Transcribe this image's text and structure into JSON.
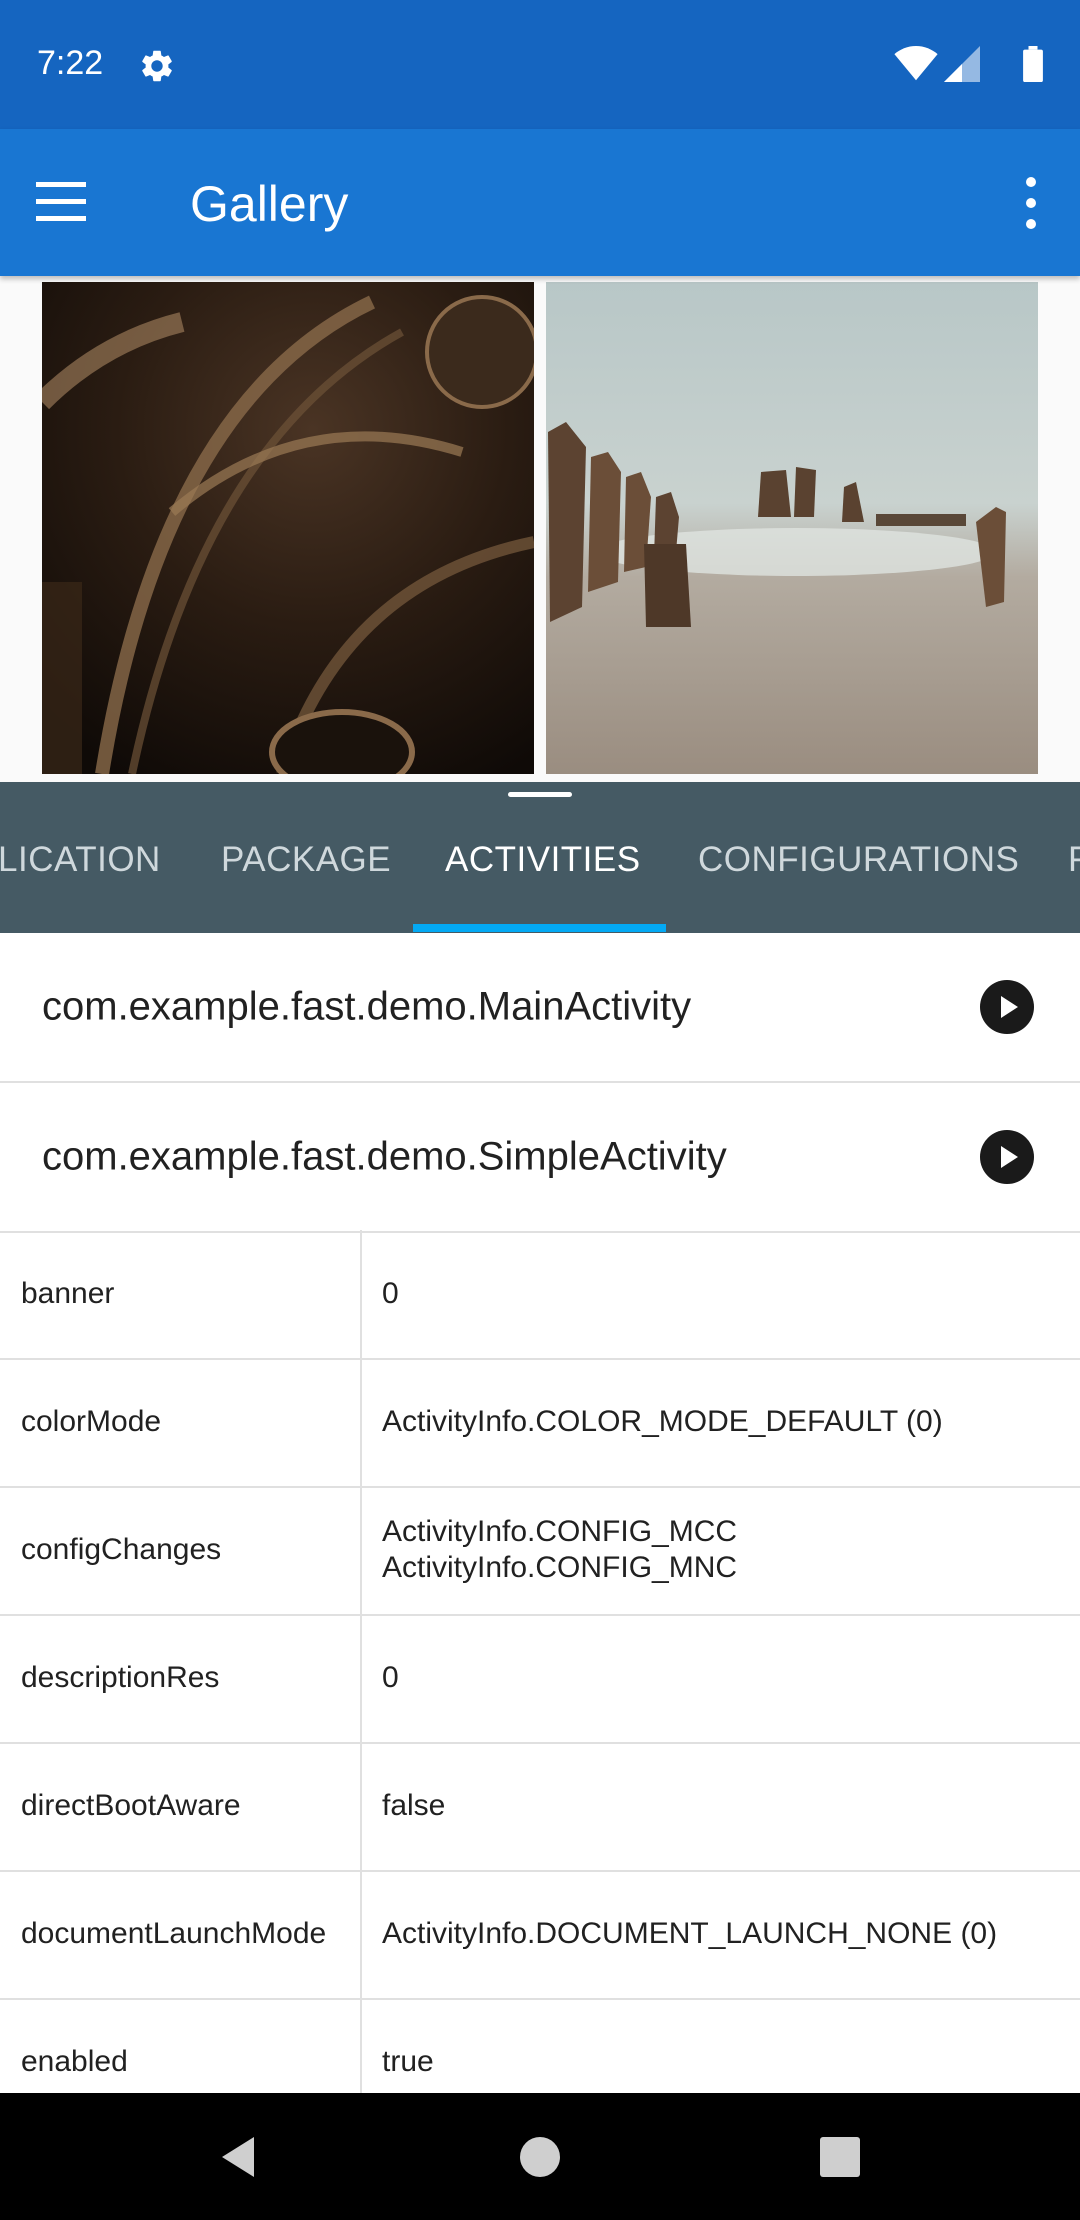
{
  "status_bar": {
    "time": "7:22",
    "icons": [
      "settings-icon",
      "wifi-icon",
      "cell-signal-icon",
      "battery-icon"
    ]
  },
  "app_bar": {
    "title": "Gallery",
    "background": "#1976d2",
    "icons": [
      "menu-icon",
      "more-vert-icon"
    ]
  },
  "gallery": {
    "photos": [
      {
        "name": "cathedral-ceiling-photo"
      },
      {
        "name": "beach-posts-photo"
      }
    ]
  },
  "tabs": {
    "items": [
      {
        "label": "LICATION"
      },
      {
        "label": "PACKAGE"
      },
      {
        "label": "ACTIVITIES",
        "active": true
      },
      {
        "label": "CONFIGURATIONS"
      },
      {
        "label": "F"
      }
    ],
    "background": "#455a64",
    "indicator_color": "#03a9f4"
  },
  "activities": [
    {
      "name": "com.example.fast.demo.MainActivity",
      "icon": "play-circle-icon"
    },
    {
      "name": "com.example.fast.demo.SimpleActivity",
      "icon": "play-circle-icon"
    }
  ],
  "properties": [
    {
      "key": "banner",
      "value": "0"
    },
    {
      "key": "colorMode",
      "value": "ActivityInfo.COLOR_MODE_DEFAULT (0)"
    },
    {
      "key": "configChanges",
      "value": "ActivityInfo.CONFIG_MCC\nActivityInfo.CONFIG_MNC"
    },
    {
      "key": "descriptionRes",
      "value": "0"
    },
    {
      "key": "directBootAware",
      "value": "false"
    },
    {
      "key": "documentLaunchMode",
      "value": "ActivityInfo.DOCUMENT_LAUNCH_NONE (0)"
    },
    {
      "key": "enabled",
      "value": "true"
    }
  ],
  "nav_bar": {
    "icons": [
      "back-icon",
      "home-icon",
      "recents-icon"
    ]
  }
}
